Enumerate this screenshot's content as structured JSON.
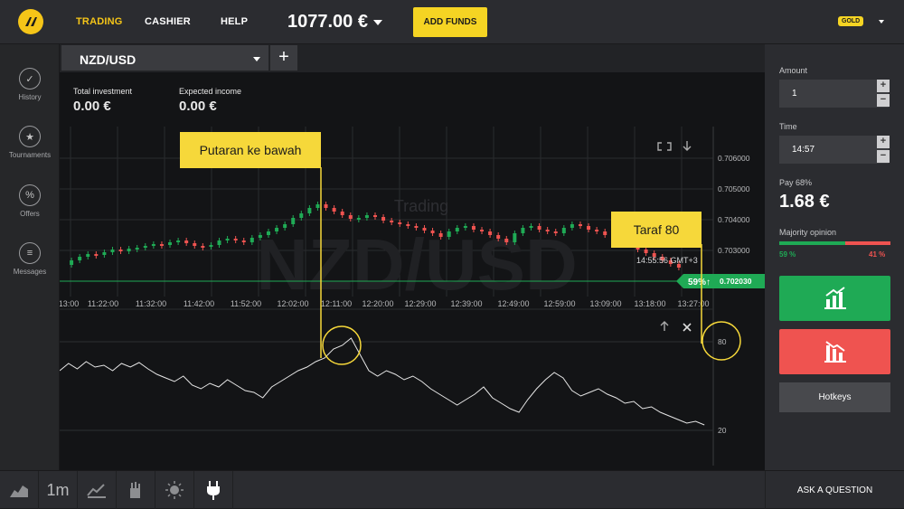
{
  "header": {
    "nav": [
      "TRADING",
      "CASHIER",
      "HELP"
    ],
    "balance": "1077.00 €",
    "add_funds": "ADD FUNDS",
    "account_badge": "GOLD",
    "accent": "#f5c518"
  },
  "sidebar": {
    "items": [
      {
        "label": "History",
        "icon": "history-icon"
      },
      {
        "label": "Tournaments",
        "icon": "tournaments-icon"
      },
      {
        "label": "Offers",
        "icon": "offers-icon"
      },
      {
        "label": "Messages",
        "icon": "messages-icon"
      }
    ]
  },
  "tabs": {
    "asset": "NZD/USD",
    "add": "+"
  },
  "stats": {
    "total_investment_label": "Total investment",
    "total_investment": "0.00 €",
    "expected_income_label": "Expected income",
    "expected_income": "0.00 €"
  },
  "chart": {
    "watermark_small": "Trading",
    "watermark_big": "NZD/USD",
    "price_ticks": [
      "0.706000",
      "0.705000",
      "0.704000",
      "0.703000"
    ],
    "time_ticks": [
      "13:00",
      "11:22:00",
      "11:32:00",
      "11:42:00",
      "11:52:00",
      "12:02:00",
      "12:11:00",
      "12:20:00",
      "12:29:00",
      "12:39:00",
      "12:49:00",
      "12:59:00",
      "13:09:00",
      "13:18:00",
      "13:27:00"
    ],
    "clock": "14:55:56 GMT+3",
    "payout_tag": "59%↑",
    "current_price": "0.702030",
    "indicator_ticks": [
      "80",
      "20"
    ],
    "up_color": "#1faa55",
    "down_color": "#ef5350"
  },
  "callouts": {
    "left": "Putaran ke bawah",
    "right": "Taraf 80",
    "color": "#f6d83a"
  },
  "panel": {
    "amount_label": "Amount",
    "amount": "1",
    "time_label": "Time",
    "time": "14:57",
    "pay_label": "Pay 68%",
    "pay_value": "1.68 €",
    "majority_label": "Majority opinion",
    "majority_up": "59 %",
    "majority_down": "41 %",
    "majority_up_fraction": 0.59,
    "hotkeys": "Hotkeys",
    "call_color": "#1faa55",
    "put_color": "#ef5350"
  },
  "bottom": {
    "timeframe": "1m",
    "ask": "ASK A QUESTION"
  }
}
